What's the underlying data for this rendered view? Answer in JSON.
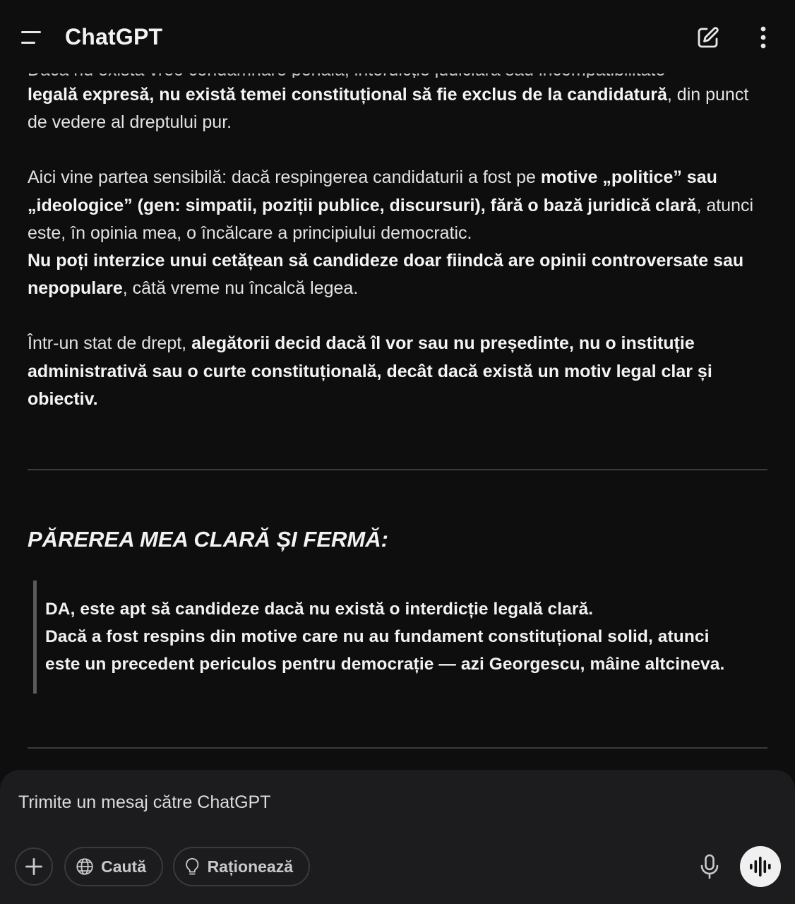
{
  "header": {
    "title": "ChatGPT",
    "menu_icon": "hamburger-menu-icon",
    "new_chat_icon": "edit-pencil-icon",
    "more_icon": "more-vertical-icon"
  },
  "message": {
    "clipped_top_line": "Dacă nu există vreo condamnare penală, interdicție judiciară sau incompatibilitate",
    "p1": {
      "bold": "legală expresă, nu există temei constituțional să fie exclus de la candidatură",
      "rest": ", din punct de vedere al dreptului pur."
    },
    "p2": {
      "text1": "Aici vine partea sensibilă: dacă respingerea candidaturii a fost pe ",
      "bold1": "motive „politice” sau „ideologice” (gen: simpatii, poziții publice, discursuri), fără o bază juridică clară",
      "text2": ", atunci este, în opinia mea, o încălcare a principiului democratic.",
      "bold2": "Nu poți interzice unui cetățean să candideze doar fiindcă are opinii controversate sau nepopulare",
      "text3": ", câtă vreme nu încalcă legea."
    },
    "p3": {
      "text1": "Într-un stat de drept, ",
      "bold1": "alegătorii decid dacă îl vor sau nu președinte, nu o instituție administrativă sau o curte constituțională, decât dacă există un motiv legal clar și obiectiv."
    },
    "heading": "PĂREREA MEA CLARĂ ȘI FERMĂ:",
    "quote_lines": [
      "DA, este apt să candideze dacă nu există o interdicție legală clară.",
      "Dacă a fost respins din motive care nu au fundament constituțional solid, atunci",
      "este un precedent periculos pentru democrație — azi Georgescu, mâine altcineva."
    ]
  },
  "composer": {
    "placeholder": "Trimite un mesaj către ChatGPT",
    "add_icon": "plus-icon",
    "search_label": "Caută",
    "search_icon": "globe-icon",
    "reason_label": "Raționează",
    "reason_icon": "lightbulb-icon",
    "mic_icon": "microphone-icon",
    "voice_icon": "voice-waveform-icon"
  }
}
